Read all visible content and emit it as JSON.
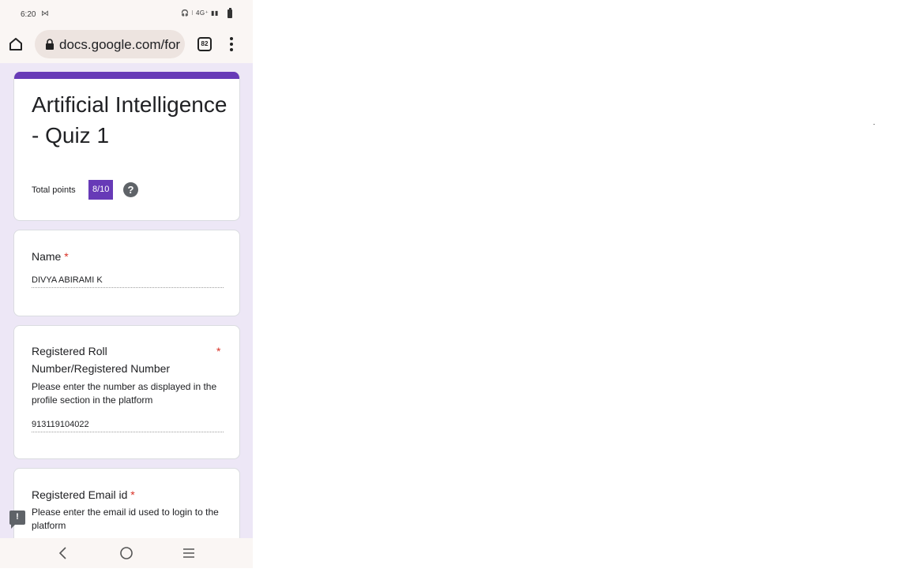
{
  "status_bar": {
    "time": "6:20",
    "mail_glyph": "⋈",
    "right_indicators": "🎧 ⁝ 4G⁺ ▮▮"
  },
  "browser": {
    "url": "docs.google.com/for",
    "tab_count": "82"
  },
  "form": {
    "title": "Artificial Intelligence - Quiz 1",
    "accent_color": "#673ab7",
    "total_points_label": "Total points",
    "score": "8/10",
    "help_glyph": "?",
    "questions": [
      {
        "label": "Name",
        "required_mark": "*",
        "answer": "DIVYA ABIRAMI K"
      },
      {
        "label": "Registered Roll Number/Registered Number",
        "required_mark": "*",
        "description": "Please enter the number as displayed in the profile section in the platform",
        "answer": "913119104022"
      },
      {
        "label": "Registered Email id",
        "required_mark": "*",
        "description": "Please enter the email id used to login to the platform"
      }
    ]
  },
  "feedback": {
    "glyph": "!"
  },
  "icons": [
    "home-icon",
    "lock-icon",
    "tabs-icon",
    "menu-icon",
    "help-icon",
    "feedback-icon",
    "back-icon",
    "home-circle-icon",
    "recents-icon"
  ]
}
